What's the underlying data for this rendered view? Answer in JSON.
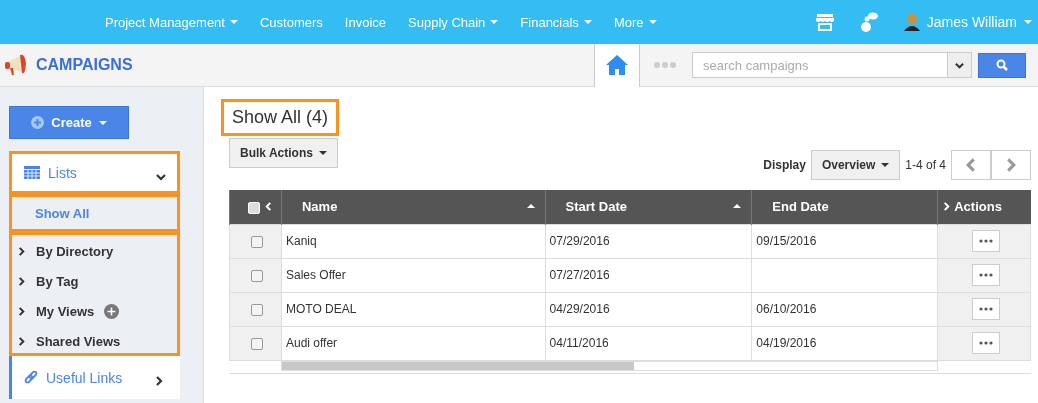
{
  "top_nav": {
    "items": [
      {
        "label": "Project Management",
        "dropdown": true
      },
      {
        "label": "Customers",
        "dropdown": false
      },
      {
        "label": "Invoice",
        "dropdown": false
      },
      {
        "label": "Supply Chain",
        "dropdown": true
      },
      {
        "label": "Financials",
        "dropdown": true
      },
      {
        "label": "More",
        "dropdown": true
      }
    ],
    "user": {
      "name": "James William"
    }
  },
  "app_bar": {
    "title": "CAMPAIGNS",
    "search": {
      "placeholder": "search campaigns"
    }
  },
  "sidebar": {
    "create_button": "Create",
    "lists": {
      "label": "Lists",
      "expanded": true,
      "highlighted": true
    },
    "show_all": {
      "label": "Show All",
      "selected": true,
      "highlighted": true
    },
    "filters_highlighted": true,
    "filters": [
      {
        "label": "By Directory",
        "addable": false
      },
      {
        "label": "By Tag",
        "addable": false
      },
      {
        "label": "My Views",
        "addable": true
      },
      {
        "label": "Shared Views",
        "addable": false
      }
    ],
    "useful_links": {
      "label": "Useful Links",
      "expanded": false
    }
  },
  "main": {
    "title": "Show All (4)",
    "title_highlighted": true,
    "bulk_actions": "Bulk Actions",
    "display_label": "Display",
    "display_value": "Overview",
    "pagination": "1-4 of 4",
    "table": {
      "select_all_checked": false,
      "columns": [
        {
          "label": "Name",
          "sortable": true
        },
        {
          "label": "Start Date",
          "sortable": true
        },
        {
          "label": "End Date",
          "sortable": false
        },
        {
          "label": "Actions",
          "sortable": false
        }
      ],
      "rows": [
        {
          "checked": false,
          "name": "Kaniq",
          "start": "07/29/2016",
          "end": "09/15/2016"
        },
        {
          "checked": false,
          "name": "Sales Offer",
          "start": "07/27/2016",
          "end": ""
        },
        {
          "checked": false,
          "name": "MOTO DEAL",
          "start": "04/29/2016",
          "end": "06/10/2016"
        },
        {
          "checked": false,
          "name": "Audi offer",
          "start": "04/11/2016",
          "end": "04/19/2016"
        }
      ]
    }
  }
}
